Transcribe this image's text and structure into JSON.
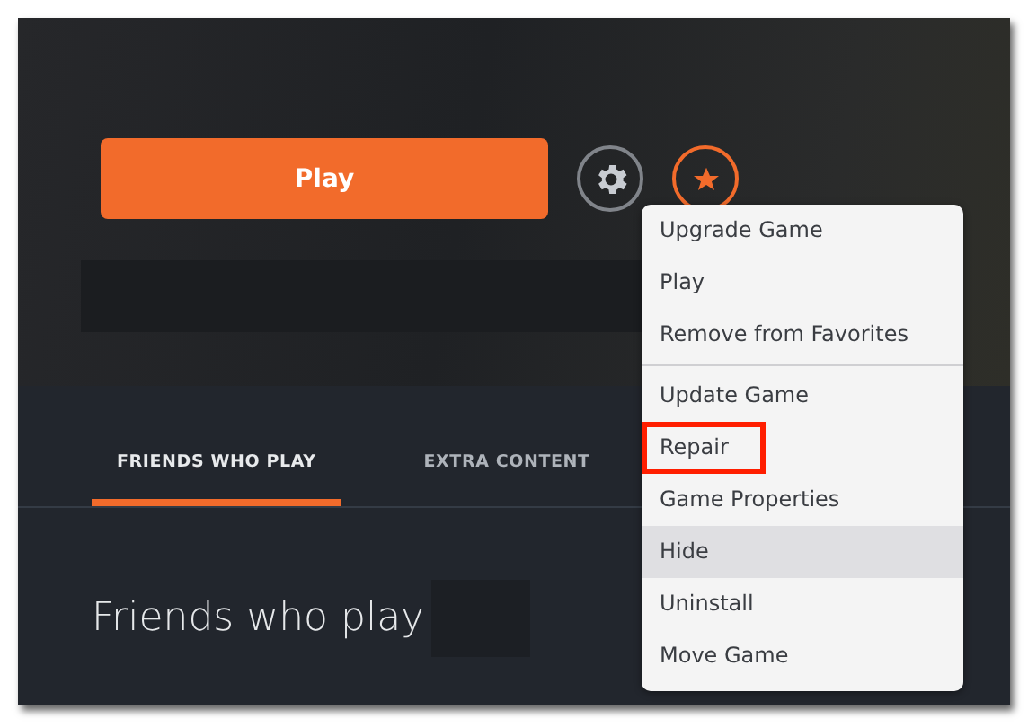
{
  "hero": {
    "play_button": "Play"
  },
  "context_menu": {
    "groups": [
      [
        {
          "label": "Upgrade Game",
          "selected": false,
          "annotated": false
        },
        {
          "label": "Play",
          "selected": false,
          "annotated": false
        },
        {
          "label": "Remove from Favorites",
          "selected": false,
          "annotated": false
        }
      ],
      [
        {
          "label": "Update Game",
          "selected": false,
          "annotated": false
        },
        {
          "label": "Repair",
          "selected": false,
          "annotated": true
        },
        {
          "label": "Game Properties",
          "selected": false,
          "annotated": false
        },
        {
          "label": "Hide",
          "selected": true,
          "annotated": false
        },
        {
          "label": "Uninstall",
          "selected": false,
          "annotated": false
        },
        {
          "label": "Move Game",
          "selected": false,
          "annotated": false
        }
      ]
    ]
  },
  "tabs": [
    {
      "label": "FRIENDS WHO PLAY",
      "selected": true
    },
    {
      "label": "EXTRA CONTENT",
      "selected": false
    }
  ],
  "section_title": "Friends who play"
}
